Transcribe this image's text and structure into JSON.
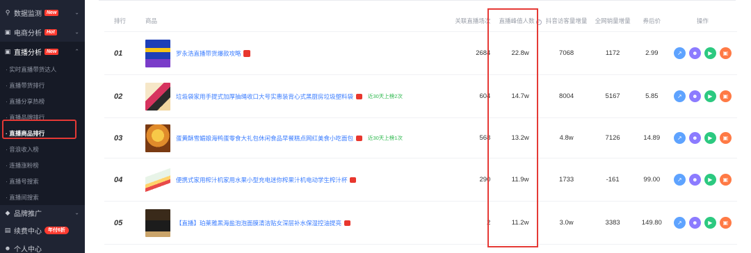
{
  "sidebar": {
    "sections_top": [
      {
        "label": "数据监测",
        "badge": "New",
        "icon": "search-icon"
      },
      {
        "label": "电商分析",
        "badge": "Hot",
        "icon": "bag-icon"
      },
      {
        "label": "直播分析",
        "badge": "New",
        "icon": "live-icon"
      }
    ],
    "sub_items": [
      "· 实时直播带货达人",
      "· 直播带货排行",
      "· 直播分享热榜",
      "· 直播品牌排行",
      "· 直播商品排行",
      "· 音浪收入榜",
      "· 连播涨粉榜",
      "· 直播号搜索",
      "· 直播间搜索"
    ],
    "sections_bottom": [
      {
        "label": "品牌推广",
        "badge": "",
        "icon": "diamond-icon"
      },
      {
        "label": "续费中心",
        "badge": "年付6折",
        "icon": "card-icon"
      },
      {
        "label": "个人中心",
        "badge": "",
        "icon": "user-icon"
      }
    ]
  },
  "table": {
    "headers": {
      "rank": "排行",
      "product": "商品",
      "sessions": "关联直播场次",
      "peak": "直播峰值人数",
      "visit": "抖音访客量增量",
      "sales": "全网销量增量",
      "price": "券后价",
      "ops": "操作"
    },
    "rows": [
      {
        "rank": "01",
        "name": "罗永浩直播带货爆款攻略",
        "note": "",
        "sessions": "2684",
        "peak": "22.8w",
        "visit": "7068",
        "sales": "1172",
        "price": "2.99"
      },
      {
        "rank": "02",
        "name": "垃圾袋家用手提式加厚抽绳收口大号实惠装背心式黑厨房垃圾塑料袋",
        "note": "近30天上榜2次",
        "sessions": "604",
        "peak": "14.7w",
        "visit": "8004",
        "sales": "5167",
        "price": "5.85"
      },
      {
        "rank": "03",
        "name": "蛋黄酥雪媚娘海鸭蛋零食大礼包休闲食品早餐糕点网红美食小吃面包",
        "note": "近30天上榜1次",
        "sessions": "568",
        "peak": "13.2w",
        "visit": "4.8w",
        "sales": "7126",
        "price": "14.89"
      },
      {
        "rank": "04",
        "name": "便携式家用榨汁机家用水果小型充电迷你榨果汁机电动学生榨汁杯",
        "note": "",
        "sessions": "290",
        "peak": "11.9w",
        "visit": "1733",
        "sales": "-161",
        "price": "99.00"
      },
      {
        "rank": "05",
        "name": "【直播】珀莱雅黑海盐泡泡面膜清洁贴女深层补水保湿控油提亮",
        "note": "",
        "sessions": "2",
        "peak": "11.2w",
        "visit": "3.0w",
        "sales": "3383",
        "price": "149.80"
      }
    ]
  },
  "colors": {
    "sidebar_bg": "#1f2433",
    "link": "#3a7cff",
    "highlight": "#e53935",
    "badge": "#ff3b30",
    "note": "#2db84d"
  }
}
